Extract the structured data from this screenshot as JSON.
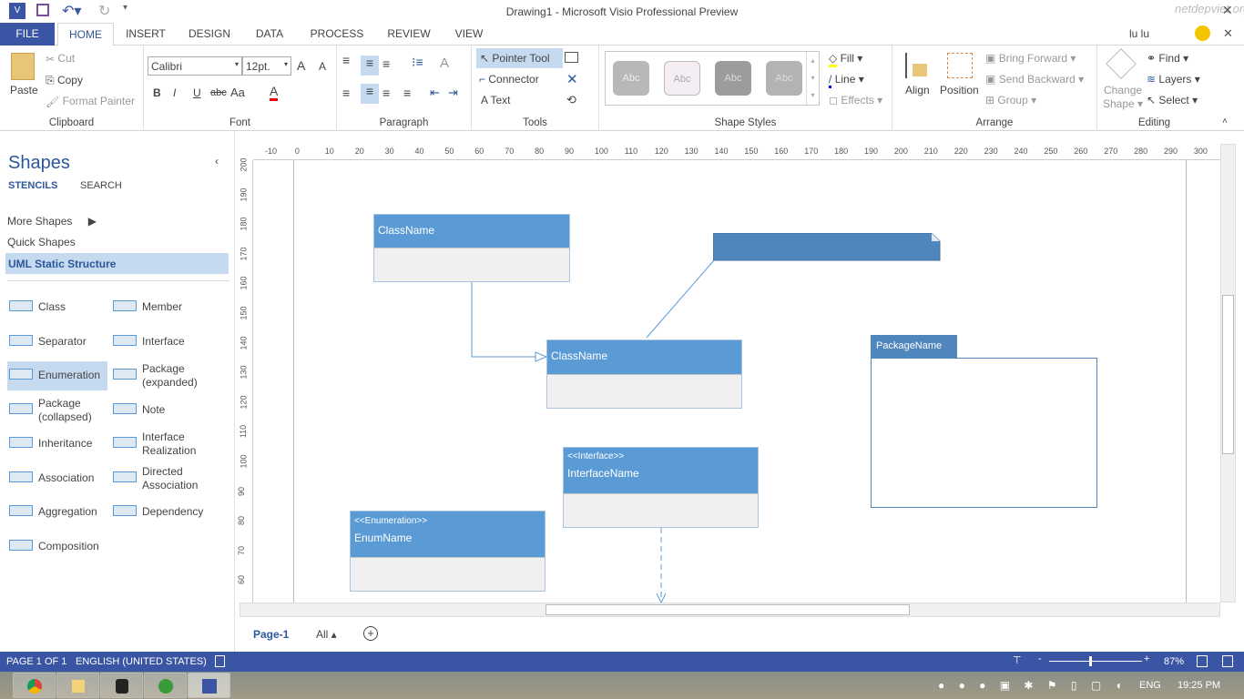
{
  "titlebar": {
    "title": "Drawing1 - Microsoft Visio Professional Preview",
    "user": "lu lu",
    "watermark": "netdepviet.org"
  },
  "tabs": [
    "FILE",
    "HOME",
    "INSERT",
    "DESIGN",
    "DATA",
    "PROCESS",
    "REVIEW",
    "VIEW"
  ],
  "ribbon": {
    "clipboard": {
      "label": "Clipboard",
      "paste": "Paste",
      "cut": "Cut",
      "copy": "Copy",
      "format_painter": "Format Painter"
    },
    "font": {
      "label": "Font",
      "font_name": "Calibri",
      "font_size": "12pt.",
      "bold": "B",
      "italic": "I",
      "underline": "U",
      "strike": "abc",
      "case": "Aa"
    },
    "paragraph": {
      "label": "Paragraph"
    },
    "tools": {
      "label": "Tools",
      "pointer": "Pointer Tool",
      "connector": "Connector",
      "text": "Text"
    },
    "shape_styles": {
      "label": "Shape Styles",
      "styles": [
        "Abc",
        "Abc",
        "Abc",
        "Abc"
      ],
      "fill": "Fill",
      "line": "Line",
      "effects": "Effects"
    },
    "arrange": {
      "label": "Arrange",
      "align": "Align",
      "position": "Position",
      "bring_forward": "Bring Forward",
      "send_backward": "Send Backward",
      "group": "Group"
    },
    "editing": {
      "label": "Editing",
      "change_shape_1": "Change",
      "change_shape_2": "Shape",
      "find": "Find",
      "layers": "Layers",
      "select": "Select"
    }
  },
  "shapes_panel": {
    "title": "Shapes",
    "tab_stencils": "STENCILS",
    "tab_search": "SEARCH",
    "more_shapes": "More Shapes",
    "quick_shapes": "Quick Shapes",
    "uml_static": "UML Static Structure",
    "items": [
      [
        "Class",
        "Member"
      ],
      [
        "Separator",
        "Interface"
      ],
      [
        "Enumeration",
        "Package (expanded)"
      ],
      [
        "Package (collapsed)",
        "Note"
      ],
      [
        "Inheritance",
        "Interface Realization"
      ],
      [
        "Association",
        "Directed Association"
      ],
      [
        "Aggregation",
        "Dependency"
      ],
      [
        "Composition",
        ""
      ]
    ]
  },
  "ruler": {
    "h": [
      "-10",
      "0",
      "10",
      "20",
      "30",
      "40",
      "50",
      "60",
      "70",
      "80",
      "90",
      "100",
      "110",
      "120",
      "130",
      "140",
      "150",
      "160",
      "170",
      "180",
      "190",
      "200",
      "210",
      "220",
      "230",
      "240",
      "250",
      "260",
      "270",
      "280",
      "290",
      "300"
    ],
    "v": [
      "200",
      "190",
      "180",
      "170",
      "160",
      "150",
      "140",
      "130",
      "120",
      "110",
      "100",
      "90",
      "80",
      "70",
      "60"
    ]
  },
  "diagram": {
    "class1": "ClassName",
    "class2": "ClassName",
    "interface_stereo": "<<Interface>>",
    "interface_name": "InterfaceName",
    "enum_stereo": "<<Enumeration>>",
    "enum_name": "EnumName",
    "package": "PackageName"
  },
  "pages": {
    "current": "Page-1",
    "all": "All"
  },
  "status": {
    "page": "PAGE 1 OF 1",
    "language": "ENGLISH (UNITED STATES)",
    "zoom": "87%",
    "zoom_level": 87
  },
  "taskbar": {
    "lang": "ENG",
    "time": "19:25 PM"
  },
  "colors": {
    "accent": "#3955a3",
    "shape": "#5b9bd5",
    "note": "#4f86bd"
  }
}
